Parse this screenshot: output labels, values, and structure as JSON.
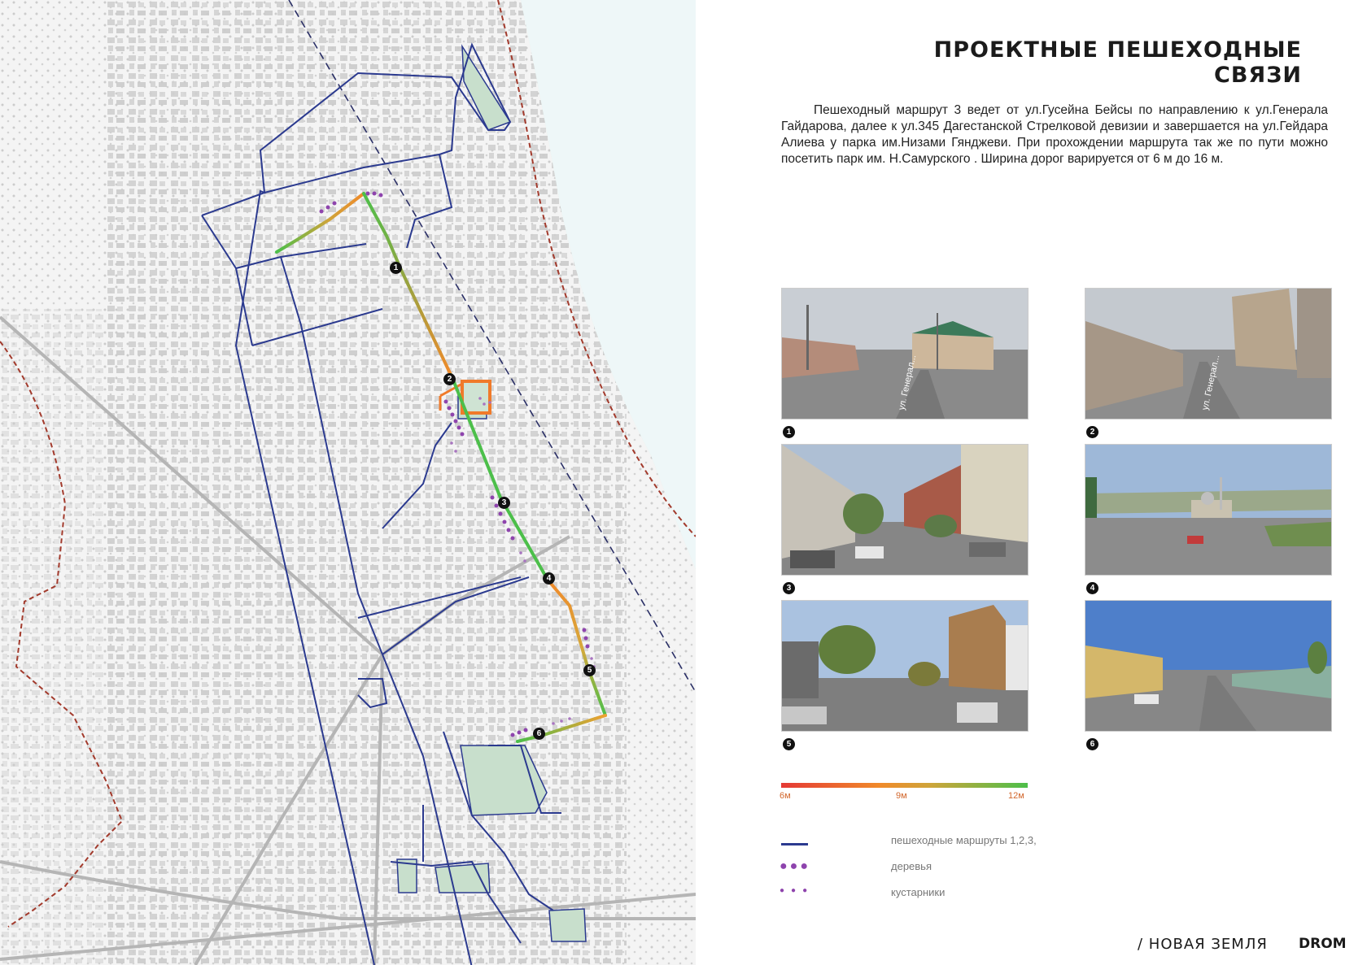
{
  "title": "ПРОЕКТНЫЕ ПЕШЕХОДНЫЕ СВЯЗИ",
  "description": "Пешеходный маршрут 3 ведет от ул.Гусейна Бейсы по направлению к ул.Генерала Гайдарова, далее к ул.345 Дагестанской Стрелковой девизии и завершается на ул.Гейдара Алиева у парка им.Низами Гянджеви. При прохождении маршрута так же по пути можно посетить парк им. Н.Самурского . Ширина дорог варируется от 6 м до 16 м.",
  "photos": [
    {
      "num": "1",
      "street_sign": "ул. Генерал..."
    },
    {
      "num": "2",
      "street_sign": "ул. Генерал..."
    },
    {
      "num": "3"
    },
    {
      "num": "4"
    },
    {
      "num": "5"
    },
    {
      "num": "6"
    }
  ],
  "route_markers": [
    "1",
    "2",
    "3",
    "4",
    "5",
    "6"
  ],
  "width_scale": {
    "min_label": "6м",
    "mid_label": "9м",
    "max_label": "12м",
    "colors": [
      "#e53935",
      "#f08a2a",
      "#4cbf4a"
    ]
  },
  "legend": {
    "routes_label": "пешеходные маршруты 1,2,3,",
    "trees_label": "деревья",
    "shrubs_label": "кустарники",
    "route_color": "#2b3a8f",
    "vegetation_color": "#8e44ad"
  },
  "brand": {
    "left": "/ НОВАЯ ЗЕМЛЯ",
    "right": "DROM"
  }
}
